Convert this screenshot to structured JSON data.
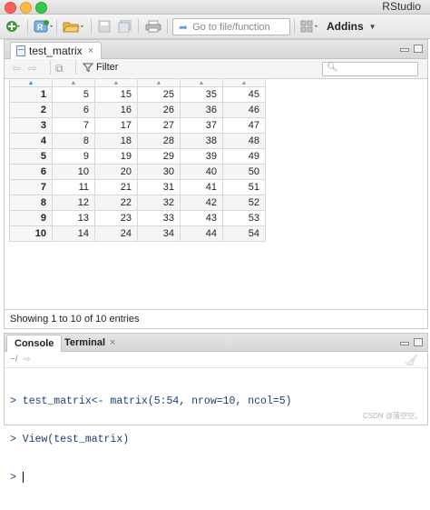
{
  "window": {
    "title": "RStudio"
  },
  "toolbar": {
    "goto_placeholder": "Go to file/function",
    "addins_label": "Addins",
    "new_icon": "plus-circle-icon",
    "open_icon": "open-folder-icon"
  },
  "source": {
    "tab_label": "test_matrix",
    "tab_close": "×",
    "filter_label": "Filter",
    "columns": [
      "",
      "",
      "",
      "",
      "",
      ""
    ],
    "rows": [
      [
        "1",
        "5",
        "15",
        "25",
        "35",
        "45"
      ],
      [
        "2",
        "6",
        "16",
        "26",
        "36",
        "46"
      ],
      [
        "3",
        "7",
        "17",
        "27",
        "37",
        "47"
      ],
      [
        "4",
        "8",
        "18",
        "28",
        "38",
        "48"
      ],
      [
        "5",
        "9",
        "19",
        "29",
        "39",
        "49"
      ],
      [
        "6",
        "10",
        "20",
        "30",
        "40",
        "50"
      ],
      [
        "7",
        "11",
        "21",
        "31",
        "41",
        "51"
      ],
      [
        "8",
        "12",
        "22",
        "32",
        "42",
        "52"
      ],
      [
        "9",
        "13",
        "23",
        "33",
        "43",
        "53"
      ],
      [
        "10",
        "14",
        "24",
        "34",
        "44",
        "54"
      ]
    ],
    "status": "Showing 1 to 10 of 10 entries"
  },
  "console": {
    "tab_console": "Console",
    "tab_terminal": "Terminal",
    "terminal_close": "×",
    "path": "~/",
    "lines": [
      "> test_matrix<- matrix(5:54, nrow=10, ncol=5)",
      "> View(test_matrix)",
      "> "
    ]
  },
  "watermark": "CSDN @落空空。",
  "colors": {
    "sort_arrow": "#3d8ad6",
    "console_text": "#1c3d73",
    "accent": "#6a9fd0"
  }
}
